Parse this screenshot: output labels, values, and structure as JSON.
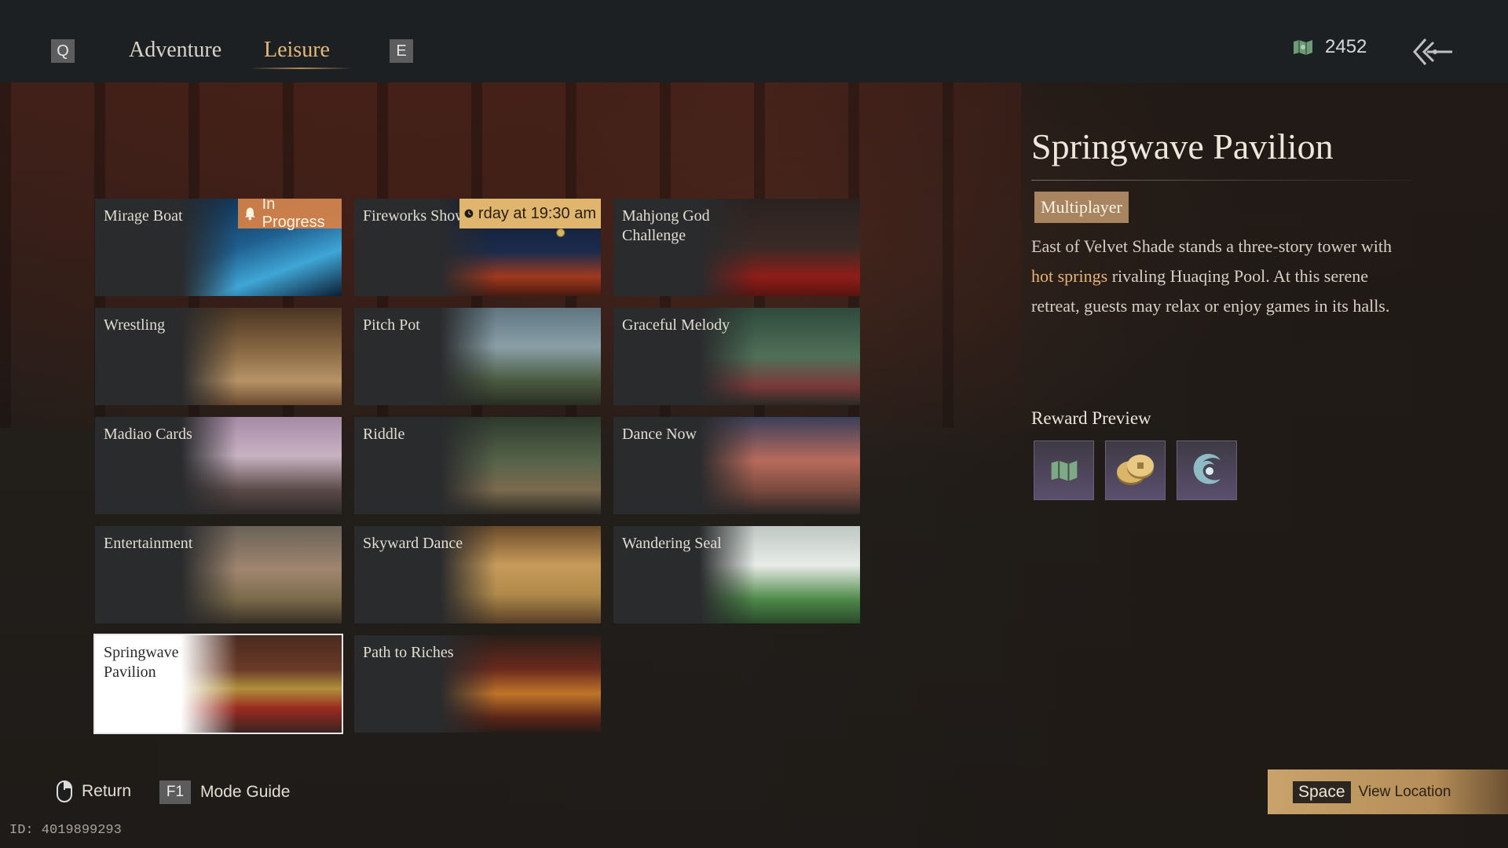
{
  "topbar": {
    "prev_key": "Q",
    "next_key": "E",
    "tabs": [
      {
        "label": "Adventure",
        "active": false
      },
      {
        "label": "Leisure",
        "active": true
      }
    ],
    "currency_value": "2452",
    "currency_icon": "map-icon"
  },
  "cards": [
    {
      "label": "Mirage Boat",
      "badge": "In Progress",
      "badge_type": "progress",
      "theme": "boat"
    },
    {
      "label": "Fireworks Show",
      "badge": "rday at 19:30 am",
      "badge_type": "time",
      "theme": "fireworks"
    },
    {
      "label": "Mahjong God Challenge",
      "theme": "mahjong"
    },
    {
      "label": "Wrestling",
      "theme": "wrestling"
    },
    {
      "label": "Pitch Pot",
      "theme": "pitchpot"
    },
    {
      "label": "Graceful Melody",
      "theme": "melody"
    },
    {
      "label": "Madiao Cards",
      "theme": "cards"
    },
    {
      "label": "Riddle",
      "theme": "riddle"
    },
    {
      "label": "Dance Now",
      "theme": "dance"
    },
    {
      "label": "Entertainment",
      "theme": "entertainment"
    },
    {
      "label": "Skyward Dance",
      "theme": "skyward"
    },
    {
      "label": "Wandering Seal",
      "theme": "seal"
    },
    {
      "label": "Springwave Pavilion",
      "theme": "pavilion",
      "selected": true
    },
    {
      "label": "Path to Riches",
      "theme": "riches"
    }
  ],
  "detail": {
    "title": "Springwave Pavilion",
    "mode": "Multiplayer",
    "desc_before": "East of Velvet Shade stands a three-story tower with ",
    "desc_highlight": "hot springs",
    "desc_after": " rivaling Huaqing Pool. At this serene retreat, guests may relax or enjoy games in its halls.",
    "reward_title": "Reward Preview",
    "rewards": [
      "map-icon",
      "coins-icon",
      "swirl-token-icon"
    ]
  },
  "bottom": {
    "return_label": "Return",
    "guide_key": "F1",
    "guide_label": "Mode Guide",
    "id_text": "ID: 4019899293",
    "action_key": "Space",
    "action_label": "View Location"
  },
  "colors": {
    "accent": "#e6b97a",
    "highlight": "#e8b478",
    "progress_badge": "#d88246",
    "time_badge": "#e0b56d",
    "mode_tag": "#a98461",
    "action_button": "#c9a36b"
  }
}
